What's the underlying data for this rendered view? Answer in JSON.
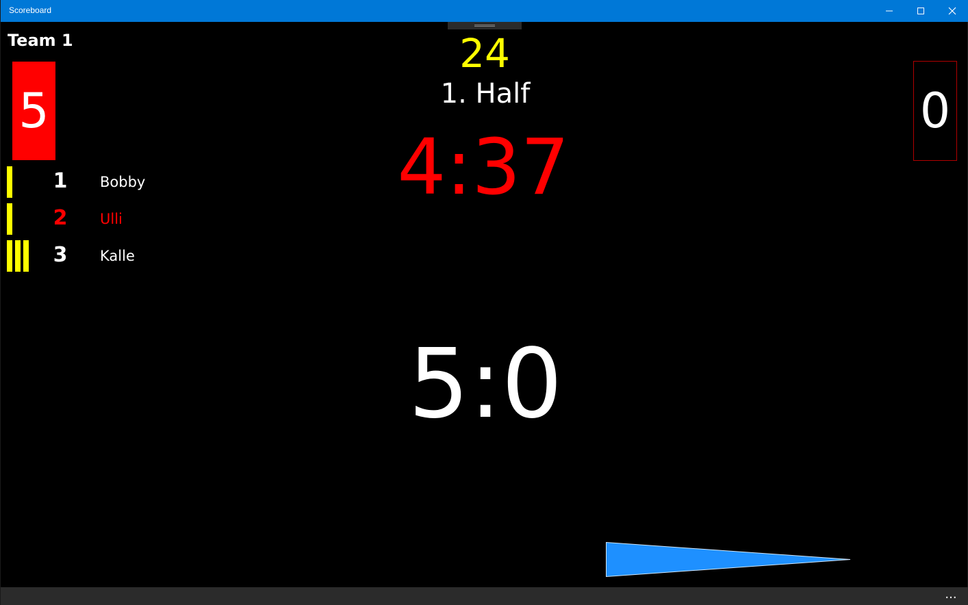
{
  "window": {
    "title": "Scoreboard"
  },
  "team": {
    "name": "Team 1",
    "score_box": "5",
    "score_box_color": "#ff0000"
  },
  "opponent": {
    "score_box": "0"
  },
  "players": [
    {
      "number": "1",
      "name": "Bobby",
      "yellow_cards": 1,
      "color": "#ffffff"
    },
    {
      "number": "2",
      "name": "Ulli",
      "yellow_cards": 1,
      "color": "#ff0000"
    },
    {
      "number": "3",
      "name": "Kalle",
      "yellow_cards": 3,
      "color": "#ffffff"
    }
  ],
  "center": {
    "shot_clock": "24",
    "period": "1. Half",
    "game_clock": "4:37",
    "score": "5:0"
  },
  "possession": {
    "icon": "possession-arrow-icon",
    "color": "#1e90ff"
  },
  "appbar": {
    "more_label": "..."
  },
  "colors": {
    "titlebar": "#0078d7",
    "card_yellow": "#ffff00",
    "shot_clock": "#ffff00",
    "game_clock": "#ff0000"
  }
}
